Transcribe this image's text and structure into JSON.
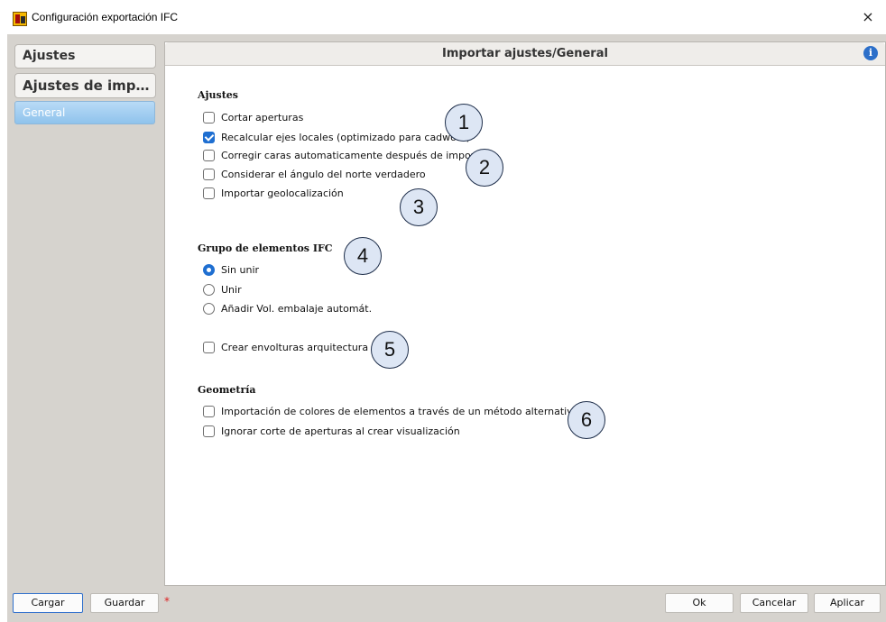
{
  "window": {
    "title": "Configuración exportación IFC",
    "close_icon": "×"
  },
  "sidebar": {
    "items": [
      {
        "label": "Ajustes"
      },
      {
        "label": "Ajustes de import..."
      }
    ],
    "sub_item": {
      "label": "General",
      "selected": true
    }
  },
  "main": {
    "header_title": "Importar ajustes/General",
    "info_icon": "i",
    "sections": {
      "ajustes": {
        "title": "Ajustes",
        "options": [
          {
            "label": "Cortar aperturas",
            "checked": false
          },
          {
            "label": "Recalcular ejes locales (optimizado para cadwork)",
            "checked": true
          },
          {
            "label": "Corregir caras automaticamente después de importar",
            "checked": false
          },
          {
            "label": "Considerar el ángulo del norte verdadero",
            "checked": false
          },
          {
            "label": "Importar geolocalización",
            "checked": false
          }
        ]
      },
      "grupo": {
        "title": "Grupo de elementos IFC",
        "radios": [
          {
            "label": "Sin unir",
            "selected": true
          },
          {
            "label": "Unir",
            "selected": false
          },
          {
            "label": "Añadir Vol. embalaje automát.",
            "selected": false
          }
        ]
      },
      "envolturas": {
        "label": "Crear envolturas arquitectura",
        "checked": false
      },
      "geometria": {
        "title": "Geometría",
        "options": [
          {
            "label": "Importación de colores de elementos a través de un método alternativo",
            "checked": false
          },
          {
            "label": "Ignorar corte de aperturas al crear visualización",
            "checked": false
          }
        ]
      }
    }
  },
  "callouts": [
    "1",
    "2",
    "3",
    "4",
    "5",
    "6"
  ],
  "footer": {
    "load": "Cargar",
    "save": "Guardar",
    "modified_marker": "*",
    "ok": "Ok",
    "cancel": "Cancelar",
    "apply": "Aplicar"
  },
  "colors": {
    "accent": "#1f6fd1",
    "frame": "#d6d3ce",
    "selected_item": "#8fc3ec",
    "callout_fill": "#dde6f4"
  }
}
